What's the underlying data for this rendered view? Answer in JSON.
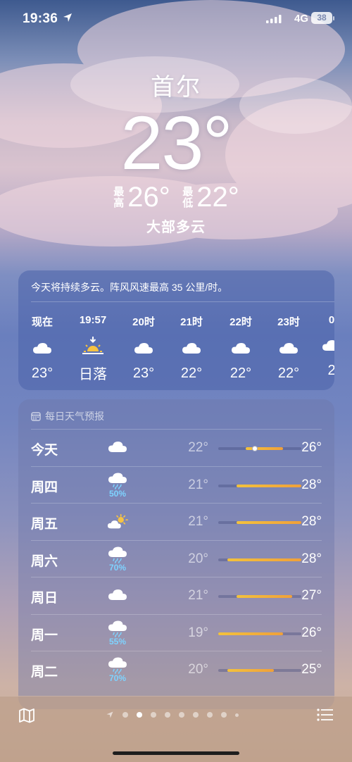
{
  "status_bar": {
    "time": "19:36",
    "network": "4G",
    "battery": "38"
  },
  "location": {
    "city": "首尔",
    "current_temp": "23°",
    "high_label": "最高",
    "high_value": "26°",
    "low_label": "最低",
    "low_value": "22°",
    "condition": "大部多云"
  },
  "hourly": {
    "summary": "今天将持续多云。阵风风速最高 35 公里/时。",
    "items": [
      {
        "label": "现在",
        "icon": "cloud-icon",
        "temp": "23°"
      },
      {
        "label": "19:57",
        "icon": "sunset-icon",
        "temp": "日落"
      },
      {
        "label": "20时",
        "icon": "cloud-icon",
        "temp": "23°"
      },
      {
        "label": "21时",
        "icon": "cloud-icon",
        "temp": "22°"
      },
      {
        "label": "22时",
        "icon": "cloud-icon",
        "temp": "22°"
      },
      {
        "label": "23时",
        "icon": "cloud-icon",
        "temp": "22°"
      },
      {
        "label": "0",
        "icon": "cloud-icon",
        "temp": "2"
      }
    ]
  },
  "daily": {
    "header": "每日天气预报",
    "range_scale": [
      19,
      28
    ],
    "days": [
      {
        "name": "今天",
        "icon": "cloud-icon",
        "precip": "",
        "low": "22°",
        "high": "26°",
        "low_v": 22,
        "high_v": 26,
        "current_v": 23
      },
      {
        "name": "周四",
        "icon": "cloud-rain-icon",
        "precip": "50%",
        "low": "21°",
        "high": "28°",
        "low_v": 21,
        "high_v": 28
      },
      {
        "name": "周五",
        "icon": "partly-sunny-icon",
        "precip": "",
        "low": "21°",
        "high": "28°",
        "low_v": 21,
        "high_v": 28
      },
      {
        "name": "周六",
        "icon": "cloud-rain-icon",
        "precip": "70%",
        "low": "20°",
        "high": "28°",
        "low_v": 20,
        "high_v": 28
      },
      {
        "name": "周日",
        "icon": "cloud-icon",
        "precip": "",
        "low": "21°",
        "high": "27°",
        "low_v": 21,
        "high_v": 27
      },
      {
        "name": "周一",
        "icon": "cloud-rain-icon",
        "precip": "55%",
        "low": "19°",
        "high": "26°",
        "low_v": 19,
        "high_v": 26
      },
      {
        "name": "周二",
        "icon": "cloud-rain-icon",
        "precip": "70%",
        "low": "20°",
        "high": "25°",
        "low_v": 20,
        "high_v": 25
      }
    ]
  },
  "bottom_bar": {
    "map_icon": "map-icon",
    "list_icon": "list-icon",
    "page_count": 9,
    "active_page": 2
  }
}
